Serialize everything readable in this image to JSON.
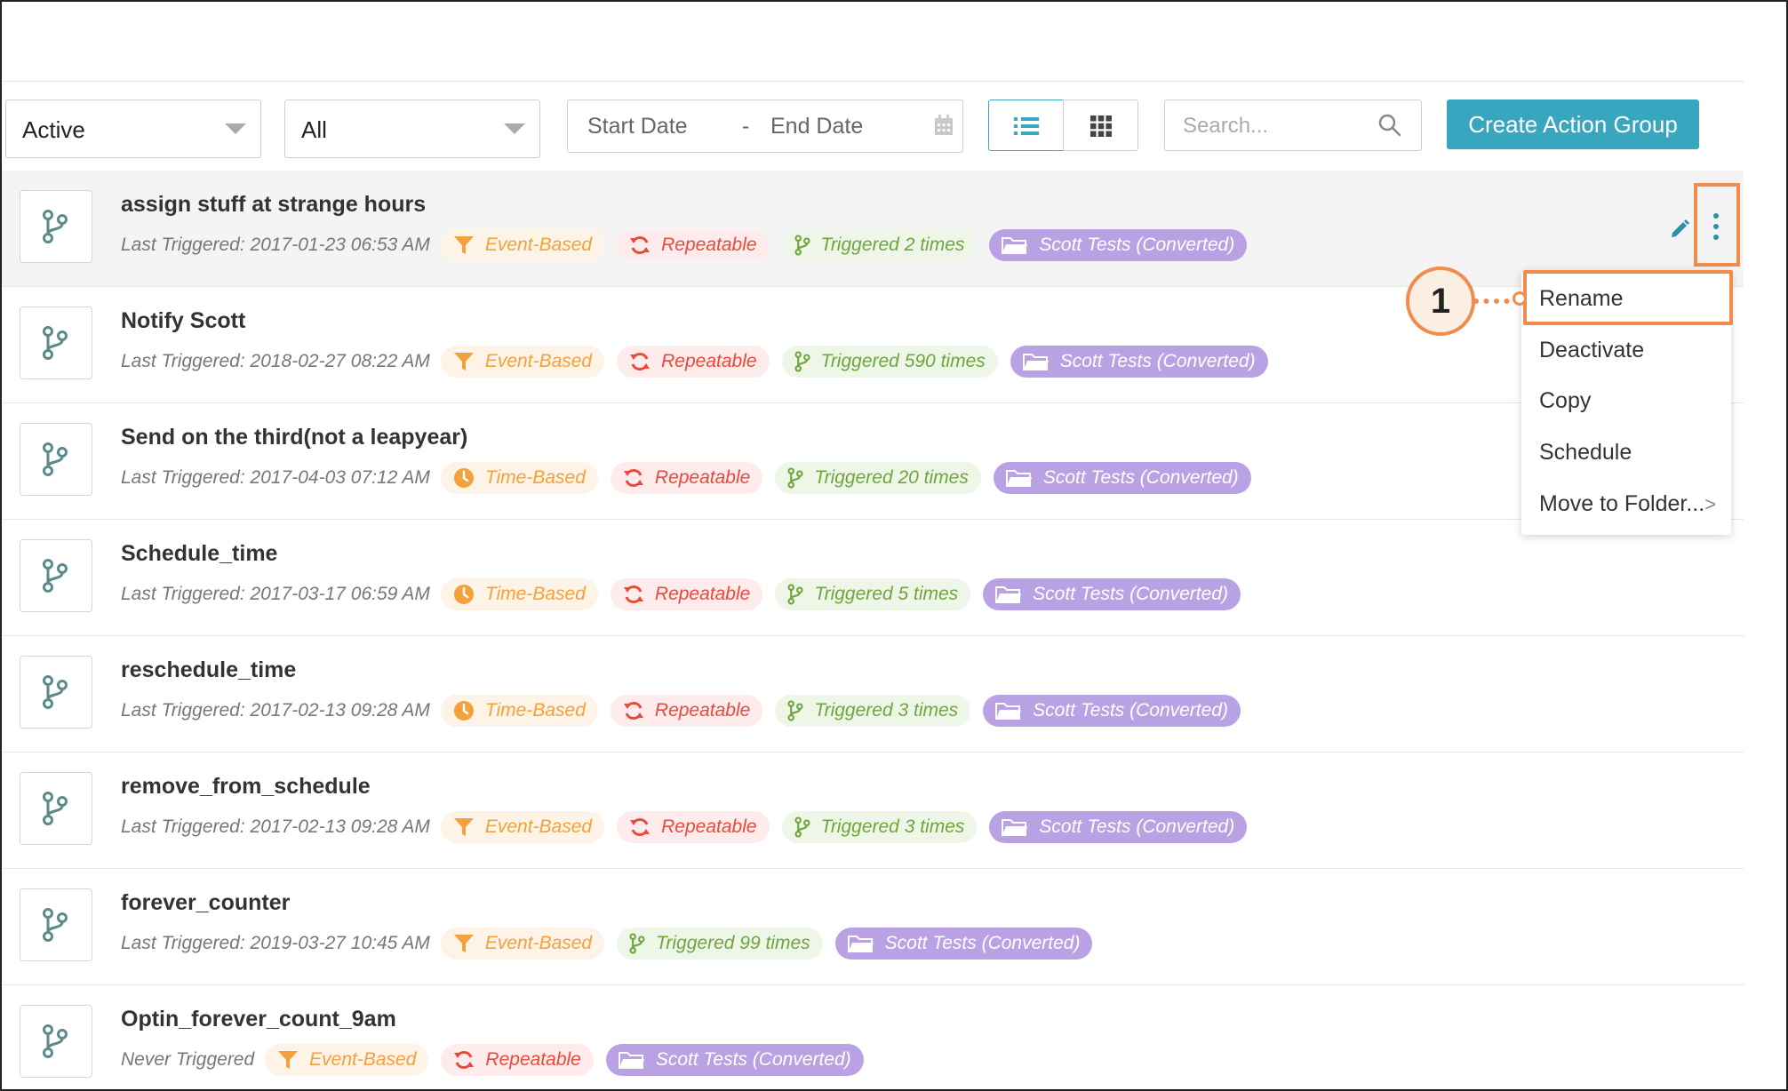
{
  "filters": {
    "status_value": "Active",
    "type_value": "All",
    "start_date_placeholder": "Start Date",
    "date_separator": "-",
    "end_date_placeholder": "End Date",
    "search_placeholder": "Search...",
    "create_button": "Create Action Group"
  },
  "rows": [
    {
      "title": "assign stuff at strange hours",
      "last": "Last Triggered: 2017-01-23 06:53 AM",
      "type": "Event-Based",
      "repeat": "Repeatable",
      "triggered": "Triggered 2 times",
      "folder": "Scott Tests (Converted)"
    },
    {
      "title": "Notify Scott",
      "last": "Last Triggered: 2018-02-27 08:22 AM",
      "type": "Event-Based",
      "repeat": "Repeatable",
      "triggered": "Triggered 590 times",
      "folder": "Scott Tests (Converted)"
    },
    {
      "title": "Send on the third(not a leapyear)",
      "last": "Last Triggered: 2017-04-03 07:12 AM",
      "type": "Time-Based",
      "repeat": "Repeatable",
      "triggered": "Triggered 20 times",
      "folder": "Scott Tests (Converted)"
    },
    {
      "title": "Schedule_time",
      "last": "Last Triggered: 2017-03-17 06:59 AM",
      "type": "Time-Based",
      "repeat": "Repeatable",
      "triggered": "Triggered 5 times",
      "folder": "Scott Tests (Converted)"
    },
    {
      "title": "reschedule_time",
      "last": "Last Triggered: 2017-02-13 09:28 AM",
      "type": "Time-Based",
      "repeat": "Repeatable",
      "triggered": "Triggered 3 times",
      "folder": "Scott Tests (Converted)"
    },
    {
      "title": "remove_from_schedule",
      "last": "Last Triggered: 2017-02-13 09:28 AM",
      "type": "Event-Based",
      "repeat": "Repeatable",
      "triggered": "Triggered 3 times",
      "folder": "Scott Tests (Converted)"
    },
    {
      "title": "forever_counter",
      "last": "Last Triggered: 2019-03-27 10:45 AM",
      "type": "Event-Based",
      "triggered": "Triggered 99 times",
      "folder": "Scott Tests (Converted)"
    },
    {
      "title": "Optin_forever_count_9am",
      "last": "Never Triggered",
      "type": "Event-Based",
      "repeat": "Repeatable",
      "folder": "Scott Tests (Converted)"
    }
  ],
  "context_menu": {
    "items": [
      "Rename",
      "Deactivate",
      "Copy",
      "Schedule",
      "Move to Folder..."
    ],
    "submenu_arrow": ">"
  },
  "callout": {
    "number": "1"
  },
  "colors": {
    "accent": "#39a6bf",
    "highlight": "#f28b4c",
    "event": "#f3a13c",
    "repeatable": "#e84a3c",
    "triggered": "#6fa53c",
    "folder": "#b9a2e3"
  },
  "icons": [
    "branch-icon",
    "filter-icon",
    "clock-icon",
    "refresh-icon",
    "folder-icon",
    "pencil-icon",
    "more-vertical-icon",
    "list-view-icon",
    "grid-view-icon",
    "search-icon",
    "calendar-icon",
    "caret-down-icon"
  ]
}
